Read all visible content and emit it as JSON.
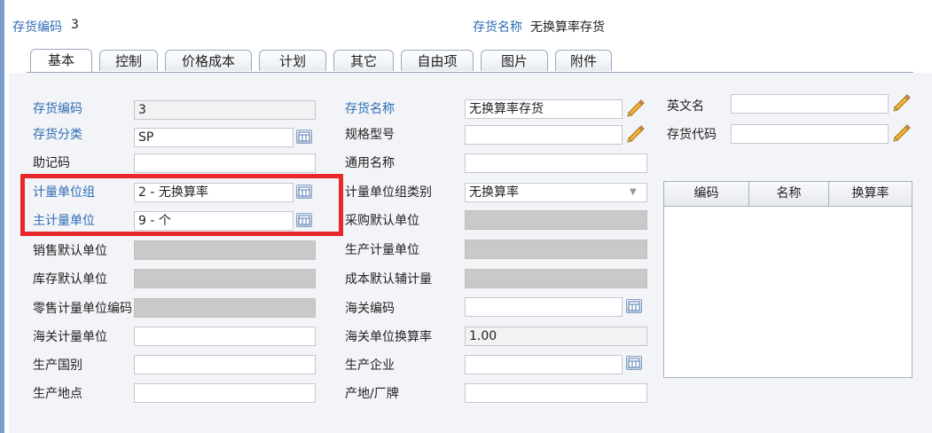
{
  "header": {
    "code_label": "存货编码",
    "code_value": "3",
    "name_label": "存货名称",
    "name_value": "无换算率存货"
  },
  "tabs": [
    "基本",
    "控制",
    "价格成本",
    "计划",
    "其它",
    "自由项",
    "图片",
    "附件"
  ],
  "form": {
    "col1": [
      {
        "label": "存货编码",
        "value": "3"
      },
      {
        "label": "存货分类",
        "value": "SP"
      },
      {
        "label": "助记码",
        "value": ""
      },
      {
        "label": "计量单位组",
        "value": "2 - 无换算率"
      },
      {
        "label": "主计量单位",
        "value": "9 - 个"
      },
      {
        "label": "销售默认单位",
        "value": ""
      },
      {
        "label": "库存默认单位",
        "value": ""
      },
      {
        "label": "零售计量单位编码",
        "value": ""
      },
      {
        "label": "海关计量单位",
        "value": ""
      },
      {
        "label": "生产国别",
        "value": ""
      },
      {
        "label": "生产地点",
        "value": ""
      }
    ],
    "col2": [
      {
        "label": "存货名称",
        "value": "无换算率存货"
      },
      {
        "label": "规格型号",
        "value": ""
      },
      {
        "label": "通用名称",
        "value": ""
      },
      {
        "label": "计量单位组类别",
        "value": "无换算率"
      },
      {
        "label": "采购默认单位",
        "value": ""
      },
      {
        "label": "生产计量单位",
        "value": ""
      },
      {
        "label": "成本默认辅计量",
        "value": ""
      },
      {
        "label": "海关编码",
        "value": ""
      },
      {
        "label": "海关单位换算率",
        "value": "1.00"
      },
      {
        "label": "生产企业",
        "value": ""
      },
      {
        "label": "产地/厂牌",
        "value": ""
      }
    ],
    "col3": [
      {
        "label": "英文名",
        "value": ""
      },
      {
        "label": "存货代码",
        "value": ""
      }
    ]
  },
  "grid": {
    "columns": [
      "编码",
      "名称",
      "换算率"
    ]
  },
  "colors": {
    "accent": "#2f6db5",
    "highlight": "#e8282b"
  }
}
